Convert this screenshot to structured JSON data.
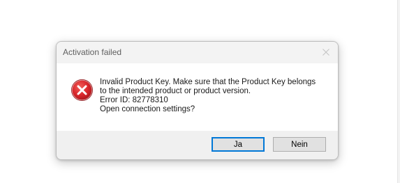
{
  "dialog": {
    "title": "Activation failed",
    "message_lines": [
      "Invalid Product Key. Make sure that the Product Key belongs",
      "to the intended product or product version.",
      "Error ID: 82778310",
      "Open connection settings?"
    ],
    "buttons": {
      "yes_label": "Ja",
      "no_label": "Nein"
    },
    "icons": {
      "close": "close-icon",
      "status": "error-icon"
    }
  },
  "colors": {
    "error_red": "#d7252a",
    "focus_blue": "#0078d7"
  }
}
